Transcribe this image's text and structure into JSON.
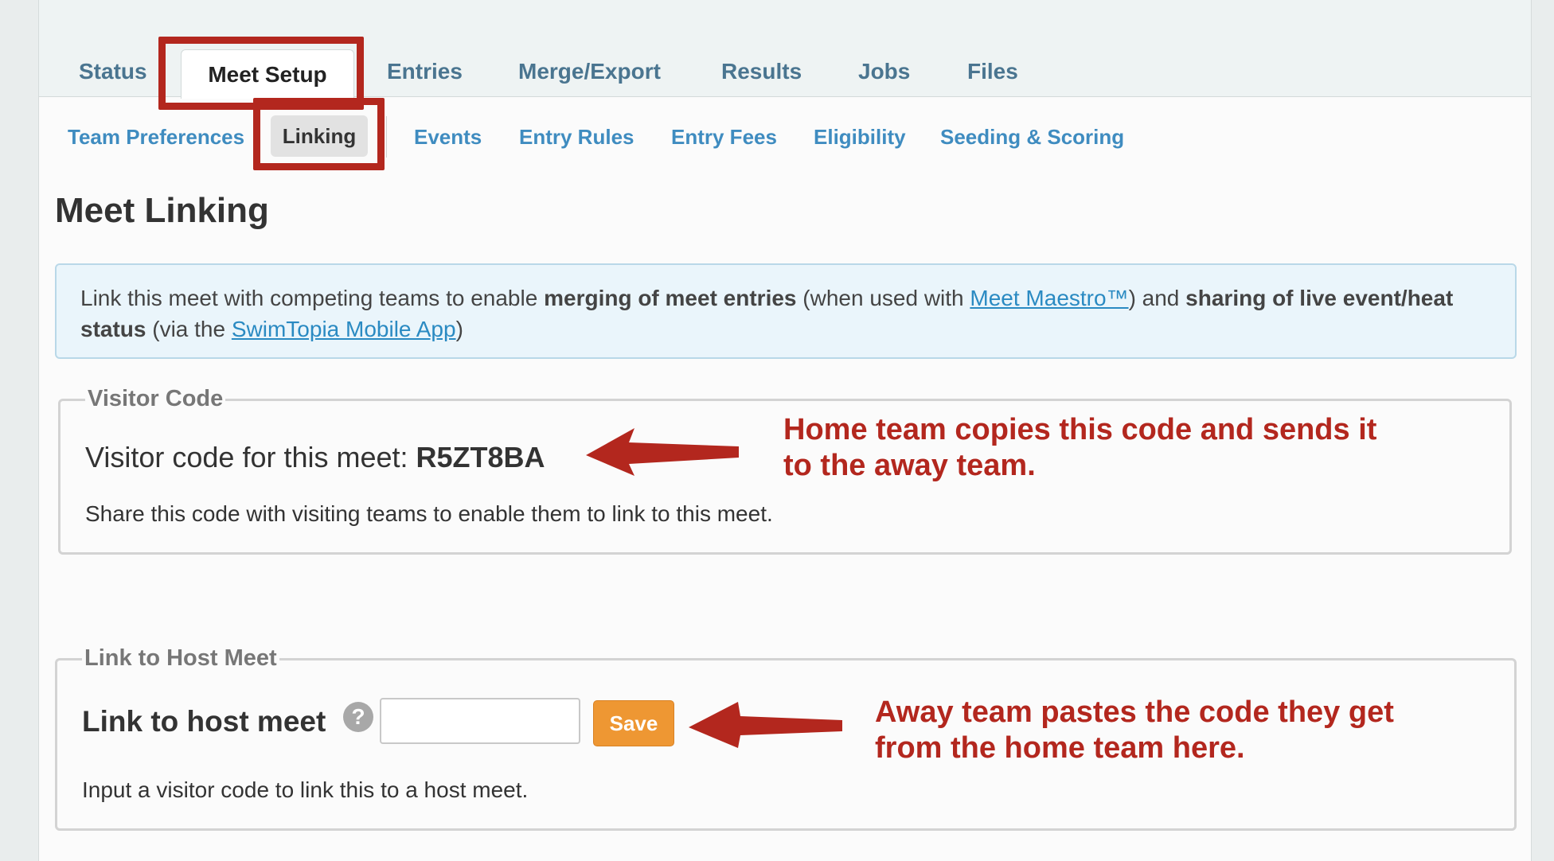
{
  "tabs": [
    "Status",
    "Meet Setup",
    "Entries",
    "Merge/Export",
    "Results",
    "Jobs",
    "Files"
  ],
  "subtabs": [
    "Team Preferences",
    "Linking",
    "Events",
    "Entry Rules",
    "Entry Fees",
    "Eligibility",
    "Seeding & Scoring"
  ],
  "page": {
    "title": "Meet Linking"
  },
  "info": {
    "t1": "Link this meet with competing teams to enable ",
    "b1": "merging of meet entries",
    "t2": " (when used with ",
    "link1": "Meet Maestro™",
    "t3": ") and ",
    "b2": "sharing of live event/heat status",
    "t4": " (via the ",
    "link2": "SwimTopia Mobile App",
    "t5": ")"
  },
  "visitor": {
    "legend": "Visitor Code",
    "label": "Visitor code for this meet: ",
    "code": "R5ZT8BA",
    "help": "Share this code with visiting teams to enable them to link to this meet."
  },
  "host": {
    "legend": "Link to Host Meet",
    "label": "Link to host meet",
    "help_icon": "?",
    "input_value": "",
    "save_label": "Save",
    "help": "Input a visitor code to link this to a host meet."
  },
  "annotations": {
    "home": "Home team copies this code and sends it to the away team.",
    "away": "Away team pastes the code they get from the home team here."
  },
  "colors": {
    "annotation": "#b3271e",
    "tab_text": "#4a7590",
    "subtab_text": "#3f8cc0",
    "save_button": "#ee9733"
  }
}
